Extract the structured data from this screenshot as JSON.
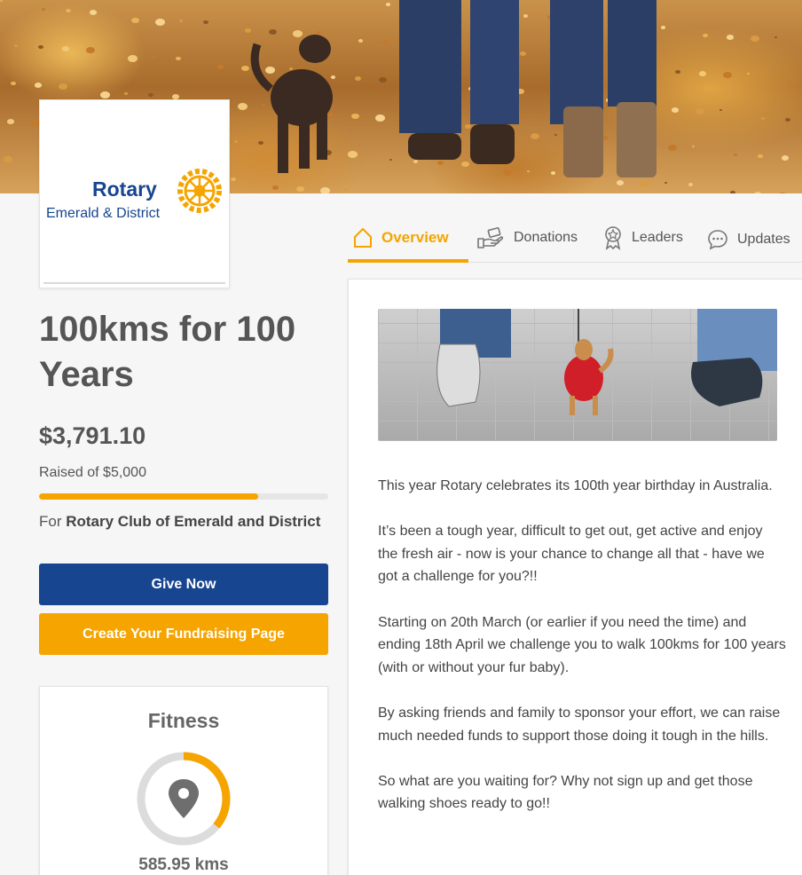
{
  "logo": {
    "wordmark": "Rotary",
    "subtitle": "Emerald & District"
  },
  "campaign": {
    "title": "100kms for 100 Years",
    "raised_amount": "$3,791.10",
    "raised_of": "Raised of $5,000",
    "progress_fraction": 0.758,
    "for_prefix": "For",
    "organization": "Rotary Club of Emerald and District"
  },
  "buttons": {
    "give_now": "Give Now",
    "create_page": "Create Your Fundraising Page"
  },
  "fitness": {
    "title": "Fitness",
    "distance": "585.95 kms",
    "progress_fraction": 0.36
  },
  "tabs": [
    {
      "label": "Overview",
      "icon": "home-icon",
      "active": true
    },
    {
      "label": "Donations",
      "icon": "donate-hand-icon",
      "active": false
    },
    {
      "label": "Leaders",
      "icon": "award-ribbon-icon",
      "active": false
    },
    {
      "label": "Updates",
      "icon": "chat-bubble-icon",
      "active": false
    }
  ],
  "story": {
    "paragraphs": [
      "This year Rotary celebrates its 100th year birthday in Australia.",
      "It’s been a tough year, difficult to get out, get active and enjoy the fresh air - now is your chance to change all that - have we got a challenge for you?!!",
      "Starting on 20th March (or earlier if you need the time) and ending 18th April we challenge you to walk 100kms for 100 years (with or without your fur baby).",
      "By asking friends and family to sponsor your effort, we can raise much needed funds to support those doing it tough in the hills.",
      "So what are you waiting for?  Why not sign up and get those walking shoes ready to go!!"
    ]
  },
  "colors": {
    "brand_blue": "#17458f",
    "brand_gold": "#f5a400"
  }
}
